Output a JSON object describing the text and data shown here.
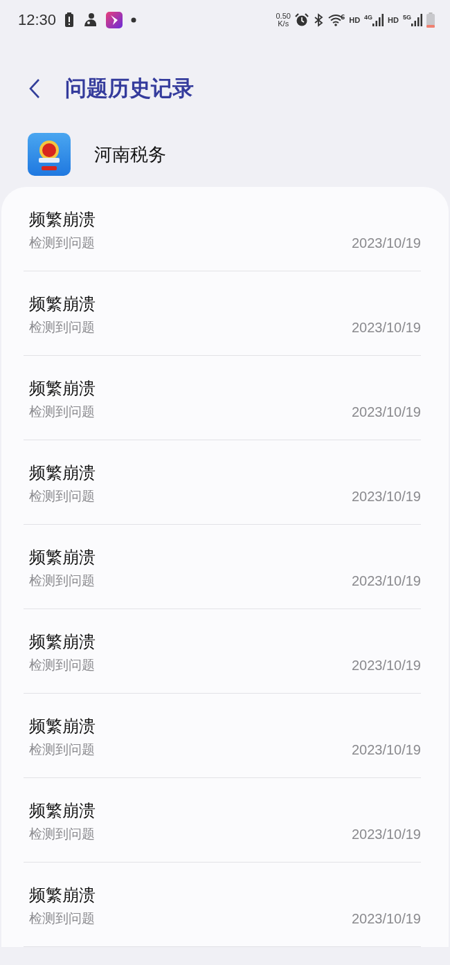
{
  "status_bar": {
    "time": "12:30",
    "speed_value": "0.50",
    "speed_unit": "K/s",
    "wifi_badge": "6",
    "labels": [
      {
        "kind": "hd",
        "text": "HD"
      },
      {
        "kind": "net",
        "text": "4G"
      },
      {
        "kind": "hd",
        "text": "HD"
      },
      {
        "kind": "net",
        "text": "5G"
      }
    ]
  },
  "header": {
    "title": "问题历史记录"
  },
  "app": {
    "name": "河南税务"
  },
  "records": [
    {
      "title": "频繁崩溃",
      "subtitle": "检测到问题",
      "date": "2023/10/19"
    },
    {
      "title": "频繁崩溃",
      "subtitle": "检测到问题",
      "date": "2023/10/19"
    },
    {
      "title": "频繁崩溃",
      "subtitle": "检测到问题",
      "date": "2023/10/19"
    },
    {
      "title": "频繁崩溃",
      "subtitle": "检测到问题",
      "date": "2023/10/19"
    },
    {
      "title": "频繁崩溃",
      "subtitle": "检测到问题",
      "date": "2023/10/19"
    },
    {
      "title": "频繁崩溃",
      "subtitle": "检测到问题",
      "date": "2023/10/19"
    },
    {
      "title": "频繁崩溃",
      "subtitle": "检测到问题",
      "date": "2023/10/19"
    },
    {
      "title": "频繁崩溃",
      "subtitle": "检测到问题",
      "date": "2023/10/19"
    },
    {
      "title": "频繁崩溃",
      "subtitle": "检测到问题",
      "date": "2023/10/19"
    }
  ]
}
